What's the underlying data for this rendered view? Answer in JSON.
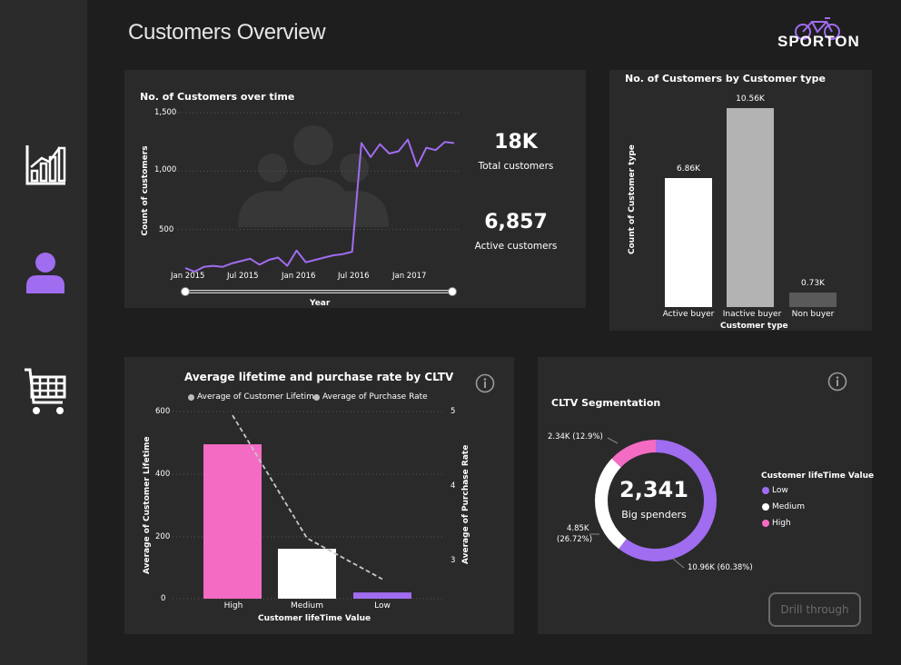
{
  "page": {
    "title": "Customers Overview",
    "brand": "SPORTON"
  },
  "sidebar": {
    "items": [
      {
        "name": "reports",
        "icon": "bar-chart-icon",
        "active": false
      },
      {
        "name": "customers",
        "icon": "user-icon",
        "active": true
      },
      {
        "name": "sales",
        "icon": "cart-icon",
        "active": false
      }
    ]
  },
  "colors": {
    "accent": "#a06cf0",
    "pink": "#f46bc3",
    "panel": "#2a2a2a",
    "background": "#1e1e1e"
  },
  "customers_over_time": {
    "title": "No. of Customers over time",
    "xlabel": "Year",
    "ylabel": "Count of customers",
    "y_ticks": [
      "1,500",
      "1,000",
      "500"
    ],
    "x_ticks": [
      "Jan 2015",
      "Jul 2015",
      "Jan 2016",
      "Jul 2016",
      "Jan 2017"
    ]
  },
  "kpis": {
    "total_value": "18K",
    "total_label": "Total customers",
    "active_value": "6,857",
    "active_label": "Active customers"
  },
  "by_type": {
    "title": "No. of Customers by Customer type",
    "xlabel": "Customer type",
    "ylabel": "Count of Customer type",
    "bars": [
      {
        "label": "Active buyer",
        "value_label": "6.86K"
      },
      {
        "label": "Inactive buyer",
        "value_label": "10.56K"
      },
      {
        "label": "Non buyer",
        "value_label": "0.73K"
      }
    ]
  },
  "lifetime": {
    "title": "Average lifetime and purchase rate by CLTV",
    "legend": [
      "Average of Customer Lifetime",
      "Average of Purchase Rate"
    ],
    "xlabel": "Customer lifeTime Value",
    "ylabel_left": "Average of Customer Lifetime",
    "ylabel_right": "Average of Purchase Rate",
    "y_left_ticks": [
      "600",
      "400",
      "200",
      "0"
    ],
    "y_right_ticks": [
      "5",
      "4",
      "3"
    ],
    "categories": [
      "High",
      "Medium",
      "Low"
    ]
  },
  "segmentation": {
    "title": "CLTV Segmentation",
    "center_value": "2,341",
    "center_label": "Big spenders",
    "legend_title": "Customer lifeTime Value",
    "legend": [
      "Low",
      "Medium",
      "High"
    ],
    "slice_labels": [
      "10.96K (60.38%)",
      "4.85K",
      "(26.72%)",
      "2.34K (12.9%)"
    ],
    "drill_label": "Drill through"
  },
  "chart_data": [
    {
      "type": "line",
      "title": "No. of Customers over time",
      "xlabel": "Year",
      "ylabel": "Count of customers",
      "ylim": [
        0,
        1500
      ],
      "x": [
        "Jan 2015",
        "Feb 2015",
        "Mar 2015",
        "Apr 2015",
        "May 2015",
        "Jun 2015",
        "Jul 2015",
        "Aug 2015",
        "Sep 2015",
        "Oct 2015",
        "Nov 2015",
        "Dec 2015",
        "Jan 2016",
        "Feb 2016",
        "Mar 2016",
        "Apr 2016",
        "May 2016",
        "Jun 2016",
        "Jul 2016",
        "Aug 2016",
        "Sep 2016",
        "Oct 2016",
        "Nov 2016",
        "Dec 2016",
        "Jan 2017",
        "Feb 2017",
        "Mar 2017",
        "Apr 2017",
        "May 2017",
        "Jun 2017"
      ],
      "series": [
        {
          "values": [
            170,
            140,
            180,
            190,
            180,
            210,
            230,
            250,
            200,
            240,
            260,
            190,
            320,
            220,
            240,
            260,
            280,
            290,
            310,
            1240,
            1120,
            1230,
            1150,
            1170,
            1270,
            1040,
            1200,
            1180,
            1250,
            1240
          ]
        }
      ]
    },
    {
      "type": "bar",
      "title": "No. of Customers by Customer type",
      "xlabel": "Customer type",
      "ylabel": "Count of Customer type",
      "categories": [
        "Active buyer",
        "Inactive buyer",
        "Non buyer"
      ],
      "values": [
        6860,
        10560,
        730
      ]
    },
    {
      "type": "bar",
      "title": "Average lifetime and purchase rate by CLTV",
      "categories": [
        "High",
        "Medium",
        "Low"
      ],
      "xlabel": "Customer lifeTime Value",
      "series": [
        {
          "name": "Average of Customer Lifetime",
          "values": [
            495,
            160,
            20
          ],
          "axis": "left",
          "ylim": [
            0,
            600
          ]
        },
        {
          "name": "Average of Purchase Rate",
          "values": [
            4.95,
            3.3,
            2.75
          ],
          "axis": "right",
          "ylim": [
            2.5,
            5
          ]
        }
      ]
    },
    {
      "type": "pie",
      "title": "CLTV Segmentation",
      "categories": [
        "Low",
        "Medium",
        "High"
      ],
      "values": [
        10960,
        4850,
        2340
      ],
      "percentages": [
        60.38,
        26.72,
        12.9
      ]
    }
  ]
}
